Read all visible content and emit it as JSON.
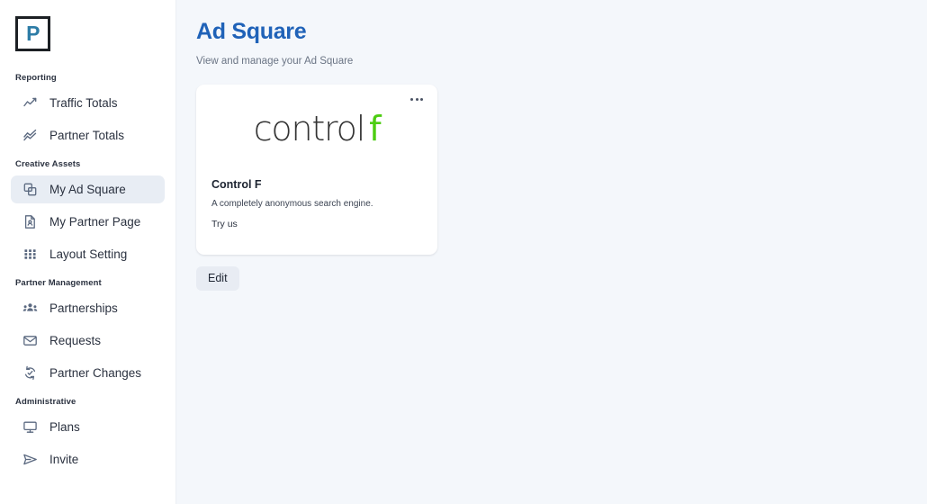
{
  "brand": {
    "logo_letter": "P",
    "logo_color": "#2d7ca6"
  },
  "sidebar": {
    "sections": [
      {
        "title": "Reporting",
        "items": [
          {
            "label": "Traffic Totals",
            "icon": "line-chart-icon",
            "active": false
          },
          {
            "label": "Partner Totals",
            "icon": "double-line-chart-icon",
            "active": false
          }
        ]
      },
      {
        "title": "Creative Assets",
        "items": [
          {
            "label": "My Ad Square",
            "icon": "copy-squares-icon",
            "active": true
          },
          {
            "label": "My Partner Page",
            "icon": "document-person-icon",
            "active": false
          },
          {
            "label": "Layout Setting",
            "icon": "grid-dots-icon",
            "active": false
          }
        ]
      },
      {
        "title": "Partner Management",
        "items": [
          {
            "label": "Partnerships",
            "icon": "people-group-icon",
            "active": false
          },
          {
            "label": "Requests",
            "icon": "envelope-icon",
            "active": false
          },
          {
            "label": "Partner Changes",
            "icon": "sync-check-icon",
            "active": false
          }
        ]
      },
      {
        "title": "Administrative",
        "items": [
          {
            "label": "Plans",
            "icon": "monitor-icon",
            "active": false
          },
          {
            "label": "Invite",
            "icon": "paper-plane-icon",
            "active": false
          }
        ]
      }
    ]
  },
  "main": {
    "title": "Ad Square",
    "title_color": "#1f62b8",
    "subtitle": "View and manage your Ad Square",
    "card": {
      "menu_icon": "ellipsis-horizontal-icon",
      "logo_text": "control",
      "logo_accent": "f",
      "logo_accent_color": "#4dcd12",
      "title": "Control F",
      "description": "A completely anonymous search engine.",
      "link_label": "Try us"
    },
    "edit_label": "Edit"
  }
}
